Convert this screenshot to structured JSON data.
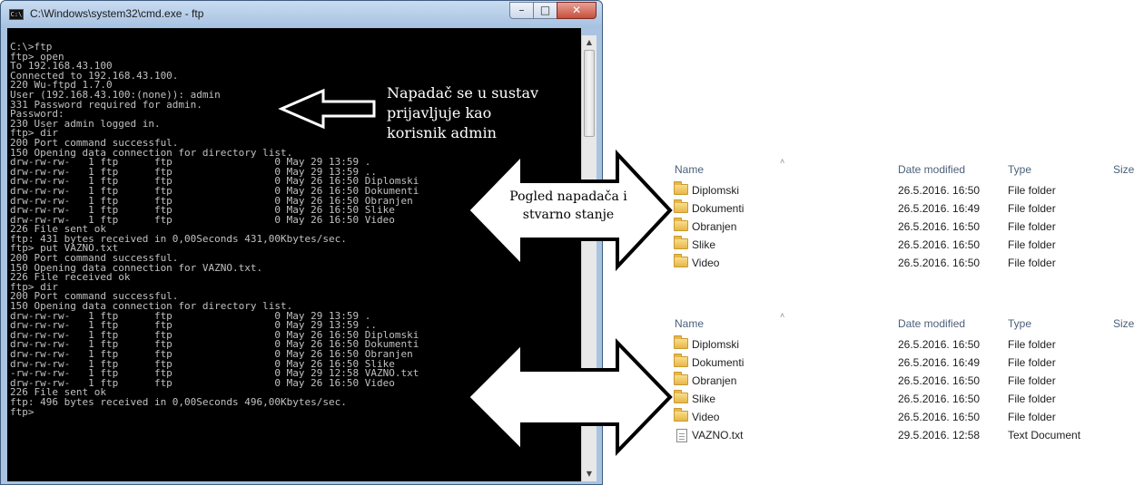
{
  "cmd": {
    "title": "C:\\Windows\\system32\\cmd.exe - ftp",
    "icon": "C:\\",
    "lines": [
      "C:\\>ftp",
      "ftp> open",
      "To 192.168.43.100",
      "Connected to 192.168.43.100.",
      "220 Wu-ftpd 1.7.0",
      "User (192.168.43.100:(none)): admin",
      "331 Password required for admin.",
      "Password:",
      "230 User admin logged in.",
      "ftp> dir",
      "200 Port command successful.",
      "150 Opening data connection for directory list.",
      "drw-rw-rw-   1 ftp      ftp                 0 May 29 13:59 .",
      "drw-rw-rw-   1 ftp      ftp                 0 May 29 13:59 ..",
      "drw-rw-rw-   1 ftp      ftp                 0 May 26 16:50 Diplomski",
      "drw-rw-rw-   1 ftp      ftp                 0 May 26 16:50 Dokumenti",
      "drw-rw-rw-   1 ftp      ftp                 0 May 26 16:50 Obranjen",
      "drw-rw-rw-   1 ftp      ftp                 0 May 26 16:50 Slike",
      "drw-rw-rw-   1 ftp      ftp                 0 May 26 16:50 Video",
      "226 File sent ok",
      "ftp: 431 bytes received in 0,00Seconds 431,00Kbytes/sec.",
      "ftp> put VAZNO.txt",
      "200 Port command successful.",
      "150 Opening data connection for VAZNO.txt.",
      "226 File received ok",
      "ftp> dir",
      "200 Port command successful.",
      "150 Opening data connection for directory list.",
      "drw-rw-rw-   1 ftp      ftp                 0 May 29 13:59 .",
      "drw-rw-rw-   1 ftp      ftp                 0 May 29 13:59 ..",
      "drw-rw-rw-   1 ftp      ftp                 0 May 26 16:50 Diplomski",
      "drw-rw-rw-   1 ftp      ftp                 0 May 26 16:50 Dokumenti",
      "drw-rw-rw-   1 ftp      ftp                 0 May 26 16:50 Obranjen",
      "drw-rw-rw-   1 ftp      ftp                 0 May 26 16:50 Slike",
      "-rw-rw-rw-   1 ftp      ftp                 0 May 29 12:58 VAZNO.txt",
      "drw-rw-rw-   1 ftp      ftp                 0 May 26 16:50 Video",
      "226 File sent ok",
      "ftp: 496 bytes received in 0,00Seconds 496,00Kbytes/sec.",
      "ftp>"
    ]
  },
  "annotations": {
    "login_note": [
      "Napadač se u sustav",
      "prijavljuje kao",
      "korisnik admin"
    ],
    "view_note": [
      "Pogled napadača i",
      "stvarno stanje"
    ]
  },
  "explorer": {
    "columns": {
      "name": "Name",
      "date": "Date modified",
      "type": "Type",
      "size": "Size"
    },
    "top_rows": [
      {
        "icon": "folder-icon",
        "name": "Diplomski",
        "date": "26.5.2016. 16:50",
        "type": "File folder"
      },
      {
        "icon": "folder-icon",
        "name": "Dokumenti",
        "date": "26.5.2016. 16:49",
        "type": "File folder"
      },
      {
        "icon": "folder-icon",
        "name": "Obranjen",
        "date": "26.5.2016. 16:50",
        "type": "File folder"
      },
      {
        "icon": "folder-icon",
        "name": "Slike",
        "date": "26.5.2016. 16:50",
        "type": "File folder"
      },
      {
        "icon": "folder-icon",
        "name": "Video",
        "date": "26.5.2016. 16:50",
        "type": "File folder"
      }
    ],
    "bottom_rows": [
      {
        "icon": "folder-icon",
        "name": "Diplomski",
        "date": "26.5.2016. 16:50",
        "type": "File folder"
      },
      {
        "icon": "folder-icon",
        "name": "Dokumenti",
        "date": "26.5.2016. 16:49",
        "type": "File folder"
      },
      {
        "icon": "folder-icon",
        "name": "Obranjen",
        "date": "26.5.2016. 16:50",
        "type": "File folder"
      },
      {
        "icon": "folder-icon",
        "name": "Slike",
        "date": "26.5.2016. 16:50",
        "type": "File folder"
      },
      {
        "icon": "folder-icon",
        "name": "Video",
        "date": "26.5.2016. 16:50",
        "type": "File folder"
      },
      {
        "icon": "text-file-icon",
        "name": "VAZNO.txt",
        "date": "29.5.2016. 12:58",
        "type": "Text Document"
      }
    ]
  }
}
